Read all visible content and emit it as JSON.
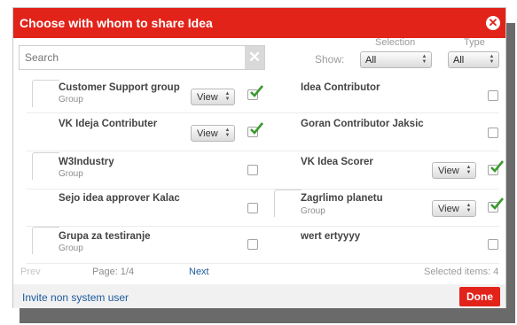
{
  "dialog": {
    "title": "Choose with whom to share Idea",
    "close_icon": "close-circle-icon"
  },
  "search": {
    "placeholder": "Search",
    "value": "",
    "clear_icon": "clear-x-icon"
  },
  "filters": {
    "show_label": "Show:",
    "selection_label": "Selection",
    "selection_value": "All",
    "type_label": "Type",
    "type_value": "All"
  },
  "items": [
    {
      "name": "Customer Support group",
      "sub": "Group",
      "permission": "View",
      "checked": true
    },
    {
      "name": "Idea Contributor",
      "sub": "",
      "permission": "",
      "checked": false
    },
    {
      "name": "VK Ideja Contributer",
      "sub": "",
      "permission": "View",
      "checked": true
    },
    {
      "name": "Goran Contributor Jaksic",
      "sub": "",
      "permission": "",
      "checked": false
    },
    {
      "name": "W3Industry",
      "sub": "Group",
      "permission": "",
      "checked": false
    },
    {
      "name": "VK Idea Scorer",
      "sub": "",
      "permission": "View",
      "checked": true
    },
    {
      "name": "Sejo idea approver Kalac",
      "sub": "",
      "permission": "",
      "checked": false
    },
    {
      "name": "Zagrlimo planetu",
      "sub": "Group",
      "permission": "View",
      "checked": true
    },
    {
      "name": "Grupa za testiranje",
      "sub": "Group",
      "permission": "",
      "checked": false
    },
    {
      "name": "wert ertyyyy",
      "sub": "",
      "permission": "",
      "checked": false
    }
  ],
  "pagination": {
    "prev": "Prev",
    "page": "Page: 1/4",
    "next": "Next",
    "selected": "Selected items: 4"
  },
  "footer": {
    "invite": "Invite non system user",
    "done": "Done"
  },
  "colors": {
    "accent": "#e2231a",
    "check": "#3a9a2e",
    "link": "#1d5a9b"
  }
}
